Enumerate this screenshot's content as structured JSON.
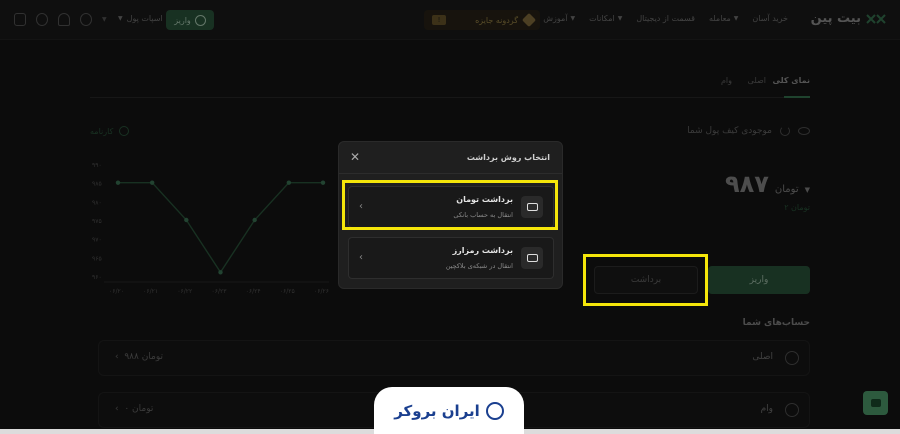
{
  "header": {
    "logo_text": "بیت پین",
    "nav": [
      "خرید آسان",
      "معامله",
      "قسمت از دیجیتال",
      "امکانات",
      "آموزش"
    ],
    "promo_text": "گردونه جایزه",
    "promo_badge": "!",
    "deposit_label": "واریز",
    "wallet_label": "اسپات پول"
  },
  "tabs": {
    "items": [
      "نمای کلی",
      "اصلی",
      "وام"
    ]
  },
  "balance": {
    "label": "موجودی کیف پول شما",
    "value": "۹۸۷",
    "unit": "تومان",
    "sub": "۲ تومان",
    "deposit_button": "واریز",
    "withdraw_button": "برداشت"
  },
  "accounts": {
    "title": "حساب‌های شما",
    "rows": [
      {
        "name": "اصلی",
        "amount": "۹۸۸ تومان"
      },
      {
        "name": "وام",
        "amount": "۰ تومان"
      }
    ]
  },
  "chart_head": "کارنامه",
  "chart_data": {
    "type": "line",
    "x": [
      "۰۶/۲۰",
      "۰۶/۲۱",
      "۰۶/۲۲",
      "۰۶/۲۳",
      "۰۶/۲۴",
      "۰۶/۲۵",
      "۰۶/۲۶"
    ],
    "y_ticks": [
      "۹۹۰",
      "۹۸۵",
      "۹۸۰",
      "۹۷۵",
      "۹۷۰",
      "۹۶۵",
      "۹۶۰"
    ],
    "values": [
      985,
      985,
      975,
      961,
      975,
      985,
      985
    ],
    "ylim": [
      960,
      990
    ],
    "color": "#2d5a3e"
  },
  "modal": {
    "title": "انتخاب روش برداشت",
    "options": [
      {
        "title": "برداشت تومان",
        "subtitle": "انتقال به حساب بانکی"
      },
      {
        "title": "برداشت رمزارز",
        "subtitle": "انتقال در شبکه‌ی بلاکچین"
      }
    ]
  },
  "watermark": "ایران بروکر",
  "colors": {
    "accent": "#2d5a3e",
    "highlight": "#f5e60a"
  }
}
